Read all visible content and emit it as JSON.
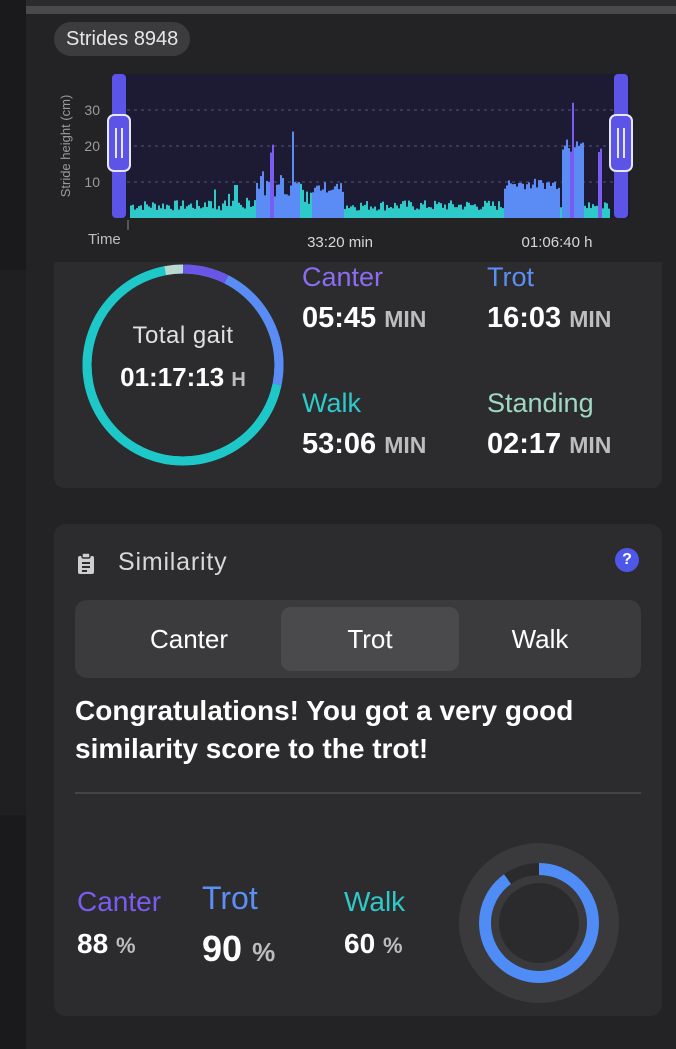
{
  "strides": {
    "label": "Strides",
    "count": "8948"
  },
  "chart_data": {
    "type": "area",
    "ylabel": "Stride height (cm)",
    "yticks": [
      "10",
      "20",
      "30"
    ],
    "ylim": [
      0,
      40
    ],
    "xlabel": "Time",
    "xticks": [
      "33:20 min",
      "01:06:40 h"
    ],
    "grid": true,
    "colors": {
      "walk": "#2ec9c9",
      "trot": "#5b8cf5",
      "canter": "#7a5cf0"
    }
  },
  "gait": {
    "total_label": "Total gait",
    "total_value": "01:17:13",
    "total_unit": "H",
    "ring": [
      {
        "name": "Walk",
        "fraction": 0.687,
        "color": "#1fc8c8"
      },
      {
        "name": "Trot",
        "fraction": 0.208,
        "color": "#5b8cf5"
      },
      {
        "name": "Canter",
        "fraction": 0.075,
        "color": "#6a55e6"
      },
      {
        "name": "Standing",
        "fraction": 0.03,
        "color": "#b8d8d0"
      }
    ],
    "canter": {
      "label": "Canter",
      "value": "05:45",
      "unit": "MIN",
      "color": "#8b6cf2"
    },
    "trot": {
      "label": "Trot",
      "value": "16:03",
      "unit": "MIN",
      "color": "#5a8ff5"
    },
    "walk": {
      "label": "Walk",
      "value": "53:06",
      "unit": "MIN",
      "color": "#2ec9c9"
    },
    "standing": {
      "label": "Standing",
      "value": "02:17",
      "unit": "MIN",
      "color": "#9fd8c2"
    }
  },
  "similarity": {
    "title": "Similarity",
    "help": "?",
    "tabs": [
      "Canter",
      "Trot",
      "Walk"
    ],
    "active_tab": "Trot",
    "message": "Congratulations! You got a very good similarity score to the trot!",
    "scores": {
      "canter": {
        "label": "Canter",
        "value": "88",
        "unit": "%",
        "color": "#7a5cf0"
      },
      "trot": {
        "label": "Trot",
        "value": "90",
        "unit": "%",
        "color": "#5a8ff5"
      },
      "walk": {
        "label": "Walk",
        "value": "60",
        "unit": "%",
        "color": "#2ec9c9"
      }
    },
    "ring_fill": 0.9
  }
}
